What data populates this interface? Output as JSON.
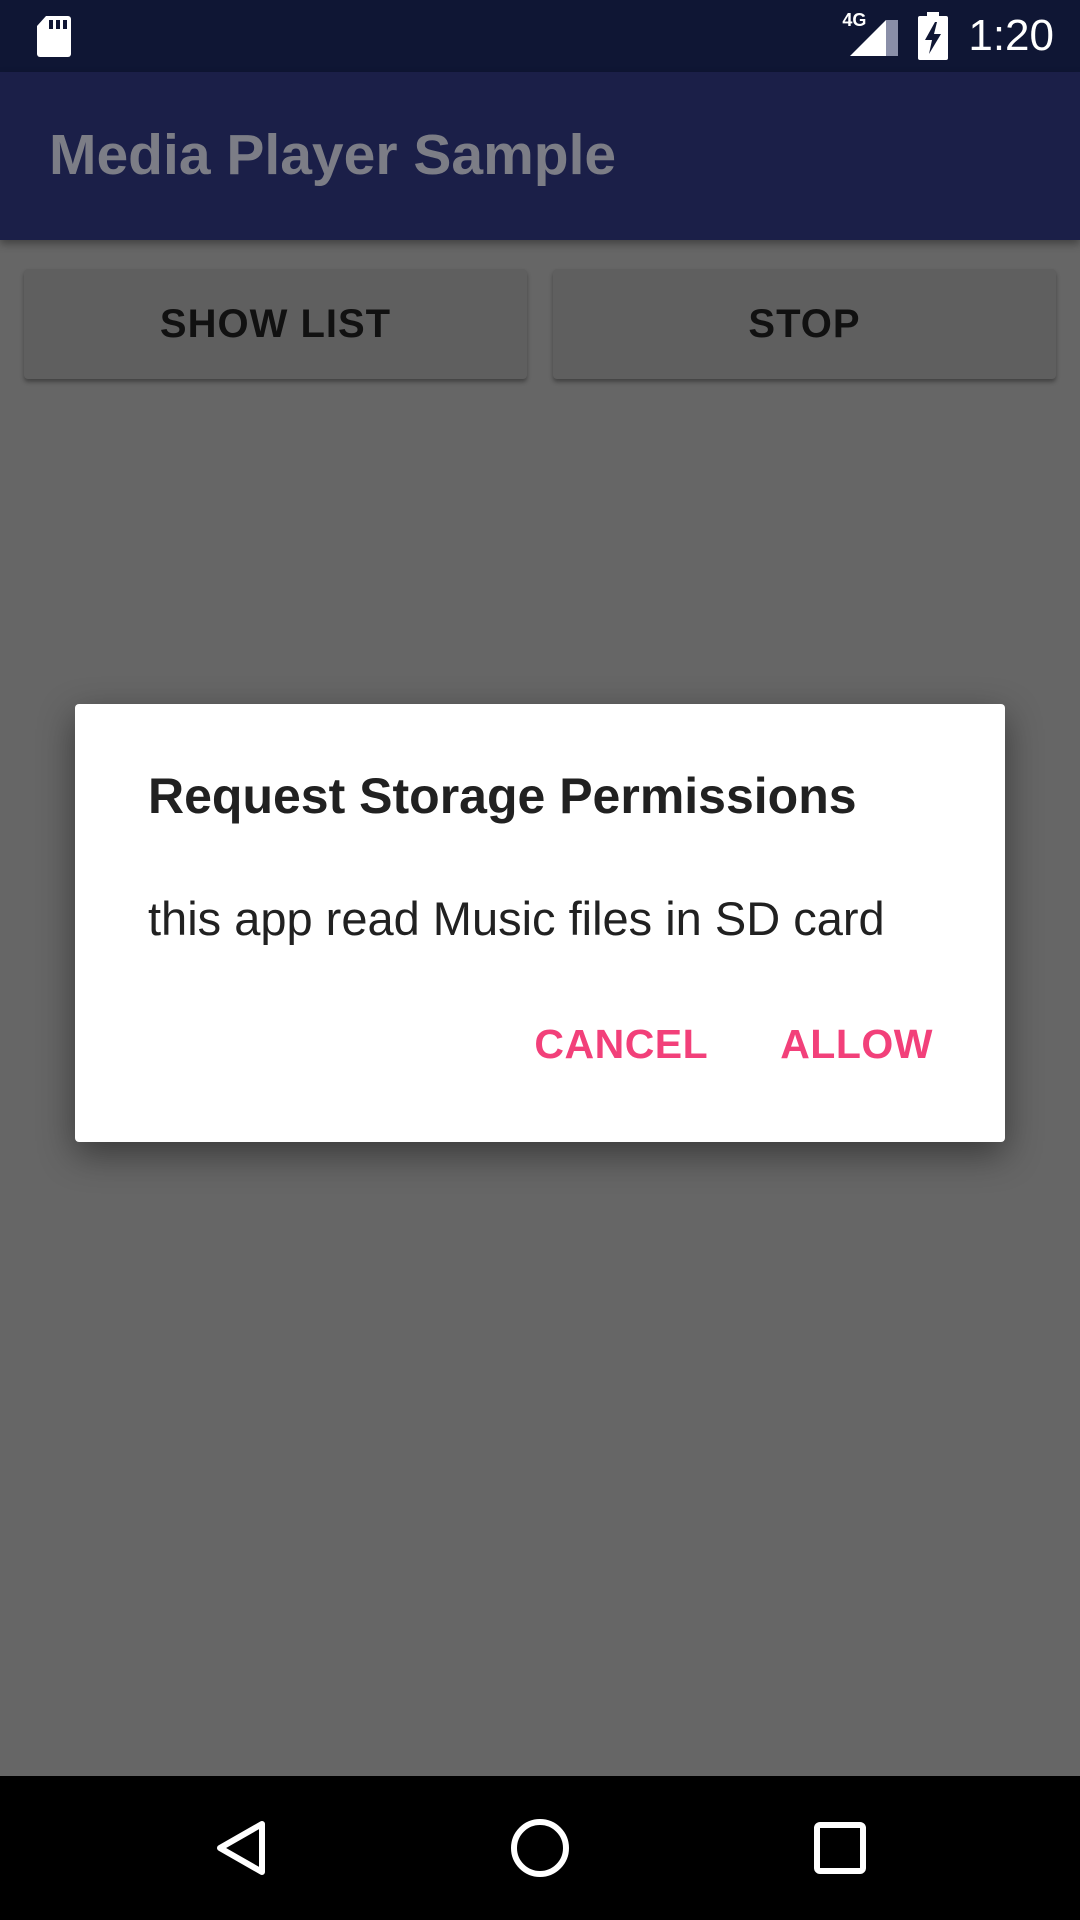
{
  "status_bar": {
    "time": "1:20",
    "network": "4G",
    "icons": [
      "sd-card-icon",
      "signal-4g-icon",
      "battery-charging-icon"
    ]
  },
  "app_bar": {
    "title": "Media Player Sample"
  },
  "toolbar": {
    "show_list_label": "SHOW LIST",
    "stop_label": "STOP"
  },
  "dialog": {
    "title": "Request Storage Permissions",
    "message": "this app read Music files in SD card",
    "cancel_label": "CANCEL",
    "allow_label": "ALLOW"
  },
  "nav_bar": {
    "icons": [
      "back-icon",
      "home-icon",
      "recents-icon"
    ]
  },
  "colors": {
    "status_bar": "#0f1634",
    "app_bar": "#1b1f48",
    "accent": "#f2407a",
    "scrim_background": "#666666"
  }
}
